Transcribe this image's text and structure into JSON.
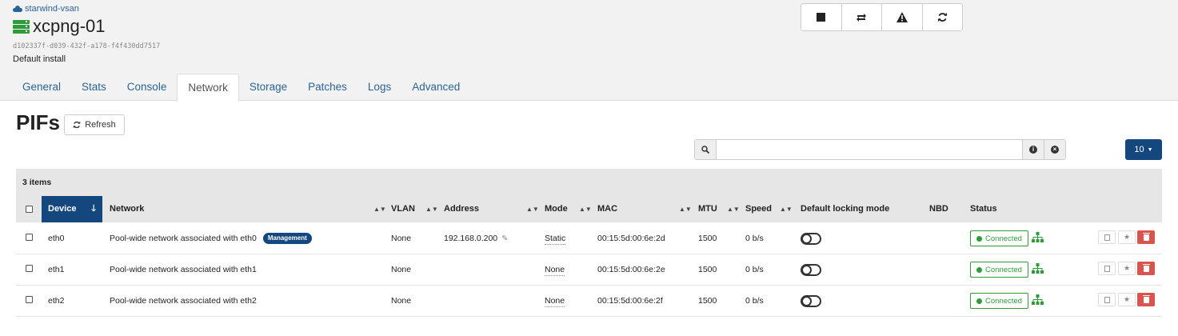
{
  "header": {
    "pool_name": "starwind-vsan",
    "host_name": "xcpng-01",
    "uuid": "d102337f-d039-432f-a178-f4f430dd7517",
    "description": "Default install",
    "actions": [
      "stop-icon",
      "restart-icon",
      "warning-icon",
      "refresh-icon"
    ]
  },
  "tabs": [
    {
      "label": "General"
    },
    {
      "label": "Stats"
    },
    {
      "label": "Console"
    },
    {
      "label": "Network",
      "active": true
    },
    {
      "label": "Storage"
    },
    {
      "label": "Patches"
    },
    {
      "label": "Logs"
    },
    {
      "label": "Advanced"
    }
  ],
  "section": {
    "title": "PIFs",
    "refresh_label": "Refresh"
  },
  "search": {
    "value": "",
    "placeholder": ""
  },
  "page_size": {
    "value": "10"
  },
  "table": {
    "items_count": "3 items",
    "columns": {
      "device": "Device",
      "network": "Network",
      "vlan": "VLAN",
      "address": "Address",
      "mode": "Mode",
      "mac": "MAC",
      "mtu": "MTU",
      "speed": "Speed",
      "locking": "Default locking mode",
      "nbd": "NBD",
      "status": "Status"
    },
    "rows": [
      {
        "device": "eth0",
        "network": "Pool-wide network associated with eth0",
        "badge": "Management",
        "vlan": "None",
        "address": "192.168.0.200",
        "mode": "Static",
        "mac": "00:15:5d:00:6e:2d",
        "mtu": "1500",
        "speed": "0 b/s",
        "status": "Connected"
      },
      {
        "device": "eth1",
        "network": "Pool-wide network associated with eth1",
        "badge": "",
        "vlan": "None",
        "address": "",
        "mode": "None",
        "mac": "00:15:5d:00:6e:2e",
        "mtu": "1500",
        "speed": "0 b/s",
        "status": "Connected"
      },
      {
        "device": "eth2",
        "network": "Pool-wide network associated with eth2",
        "badge": "",
        "vlan": "None",
        "address": "",
        "mode": "None",
        "mac": "00:15:5d:00:6e:2f",
        "mtu": "1500",
        "speed": "0 b/s",
        "status": "Connected"
      }
    ]
  },
  "colors": {
    "primary": "#14477e",
    "link": "#2a6496",
    "success": "#2e9c3a",
    "danger": "#d9534f"
  }
}
